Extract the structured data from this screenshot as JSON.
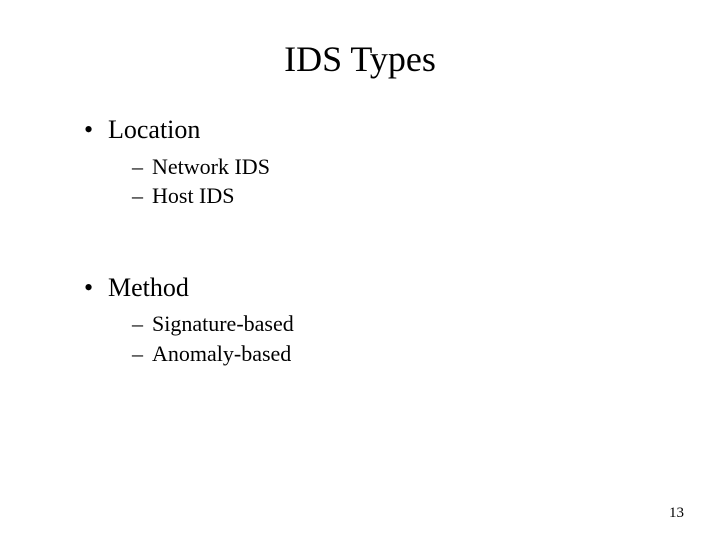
{
  "title": "IDS Types",
  "sections": [
    {
      "heading": "Location",
      "items": [
        "Network IDS",
        "Host IDS"
      ]
    },
    {
      "heading": "Method",
      "items": [
        "Signature-based",
        "Anomaly-based"
      ]
    }
  ],
  "page_number": "13"
}
